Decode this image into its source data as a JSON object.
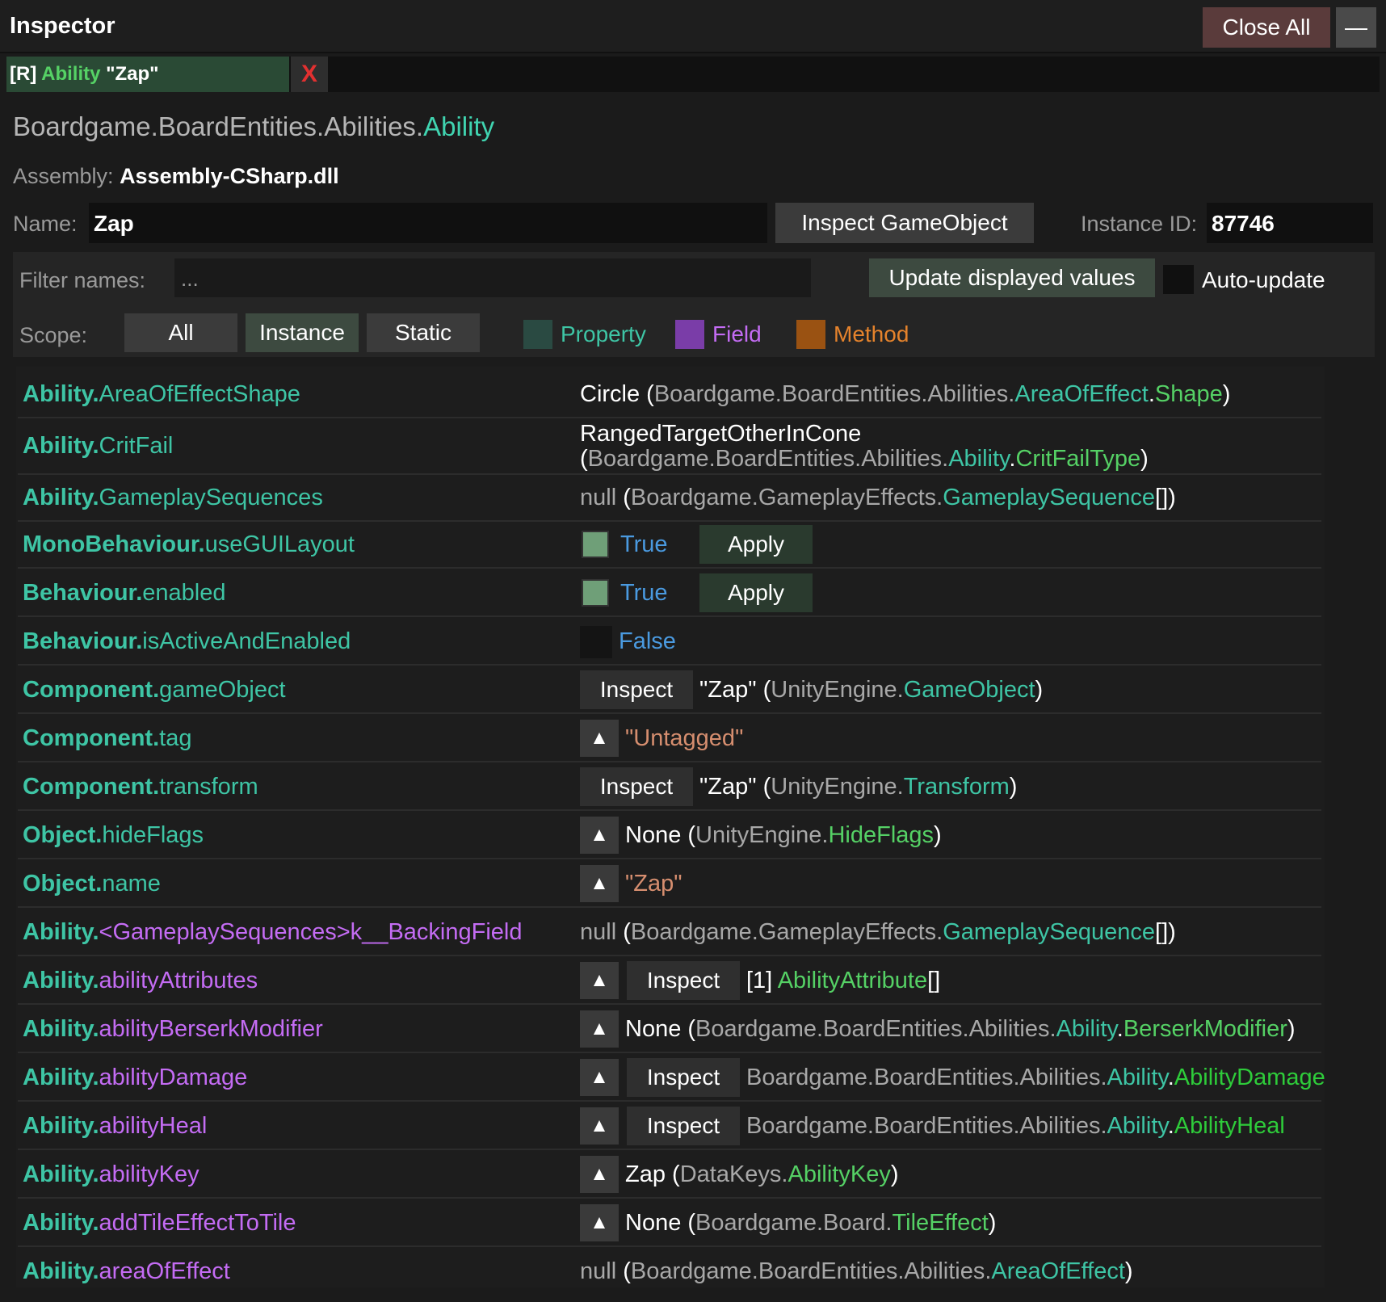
{
  "titlebar": {
    "title": "Inspector",
    "close_all": "Close All",
    "minimize_icon": "—"
  },
  "tab": {
    "prefix": "[R]",
    "kind": "Ability",
    "name": "\"Zap\"",
    "close_icon": "X"
  },
  "type_header": {
    "namespace": "Boardgame.BoardEntities.Abilities.",
    "type": "Ability"
  },
  "assembly": {
    "label": "Assembly:",
    "value": "Assembly-CSharp.dll"
  },
  "name_row": {
    "label": "Name:",
    "value": "Zap",
    "inspect_button": "Inspect GameObject",
    "instance_label": "Instance ID:",
    "instance_value": "87746"
  },
  "filter": {
    "label": "Filter names:",
    "placeholder": "...",
    "update_button": "Update displayed values",
    "auto_update": "Auto-update"
  },
  "scope": {
    "label": "Scope:",
    "all": "All",
    "instance": "Instance",
    "static": "Static",
    "legend_property": "Property",
    "legend_field": "Field",
    "legend_method": "Method"
  },
  "rows": [
    {
      "owner": "Ability.",
      "member": "AreaOfEffectShape",
      "v1": "Circle",
      "p": " (",
      "ns": "Boardgame.BoardEntities.Abilities.",
      "t1": "AreaOfEffect",
      "dot": ".",
      "t2": "Shape",
      "end": ")"
    },
    {
      "owner": "Ability.",
      "member": "CritFail",
      "v1": "RangedTargetOtherInCone",
      "p": "(",
      "ns": "Boardgame.BoardEntities.Abilities.",
      "t1": "Ability",
      "dot": ".",
      "t2": "CritFailType",
      "end": ")"
    },
    {
      "owner": "Ability.",
      "member": "GameplaySequences",
      "v1": "null",
      "p": " (",
      "ns": "Boardgame.GameplayEffects.",
      "t1": "GameplaySequence",
      "end": "[])"
    },
    {
      "owner": "MonoBehaviour.",
      "member": "useGUILayout",
      "v1": "True",
      "apply": "Apply"
    },
    {
      "owner": "Behaviour.",
      "member": "enabled",
      "v1": "True",
      "apply": "Apply"
    },
    {
      "owner": "Behaviour.",
      "member": "isActiveAndEnabled",
      "v1": "False"
    },
    {
      "owner": "Component.",
      "member": "gameObject",
      "inspect": "Inspect",
      "v1": "\"Zap\"",
      "p": " (",
      "ns": "UnityEngine.",
      "t1": "GameObject",
      "end": ")"
    },
    {
      "owner": "Component.",
      "member": "tag",
      "tri": "▲",
      "v1": "\"Untagged\""
    },
    {
      "owner": "Component.",
      "member": "transform",
      "inspect": "Inspect",
      "v1": "\"Zap\"",
      "p": " (",
      "ns": "UnityEngine.",
      "t1": "Transform",
      "end": ")"
    },
    {
      "owner": "Object.",
      "member": "hideFlags",
      "tri": "▲",
      "v1": "None",
      "p": " (",
      "ns": "UnityEngine.",
      "t1": "HideFlags",
      "end": ")"
    },
    {
      "owner": "Object.",
      "member": "name",
      "tri": "▲",
      "v1": "\"Zap\""
    },
    {
      "owner": "Ability.",
      "member": "<GameplaySequences>k__BackingField",
      "v1": "null",
      "p": " (",
      "ns": "Boardgame.GameplayEffects.",
      "t1": "GameplaySequence",
      "end": "[])"
    },
    {
      "owner": "Ability.",
      "member": "abilityAttributes",
      "tri": "▲",
      "inspect": "Inspect",
      "v1": "[1]",
      "t1": "AbilityAttribute",
      "end": "[]"
    },
    {
      "owner": "Ability.",
      "member": "abilityBerserkModifier",
      "tri": "▲",
      "v1": "None",
      "p": " (",
      "ns": "Boardgame.BoardEntities.Abilities.",
      "t1": "Ability",
      "dot": ".",
      "t2": "BerserkModifier",
      "end": ")"
    },
    {
      "owner": "Ability.",
      "member": "abilityDamage",
      "tri": "▲",
      "inspect": "Inspect",
      "ns": "Boardgame.BoardEntities.Abilities.",
      "t1": "Ability",
      "dot": ".",
      "t2": "AbilityDamage"
    },
    {
      "owner": "Ability.",
      "member": "abilityHeal",
      "tri": "▲",
      "inspect": "Inspect",
      "ns": "Boardgame.BoardEntities.Abilities.",
      "t1": "Ability",
      "dot": ".",
      "t2": "AbilityHeal"
    },
    {
      "owner": "Ability.",
      "member": "abilityKey",
      "tri": "▲",
      "v1": "Zap",
      "p": " (",
      "ns": "DataKeys.",
      "t1": "AbilityKey",
      "end": ")"
    },
    {
      "owner": "Ability.",
      "member": "addTileEffectToTile",
      "tri": "▲",
      "v1": "None",
      "p": " (",
      "ns": "Boardgame.Board.",
      "t1": "TileEffect",
      "end": ")"
    },
    {
      "owner": "Ability.",
      "member": "areaOfEffect",
      "v1": "null",
      "p": " (",
      "ns": "Boardgame.BoardEntities.Abilities.",
      "t1": "AreaOfEffect",
      "end": ")"
    }
  ]
}
